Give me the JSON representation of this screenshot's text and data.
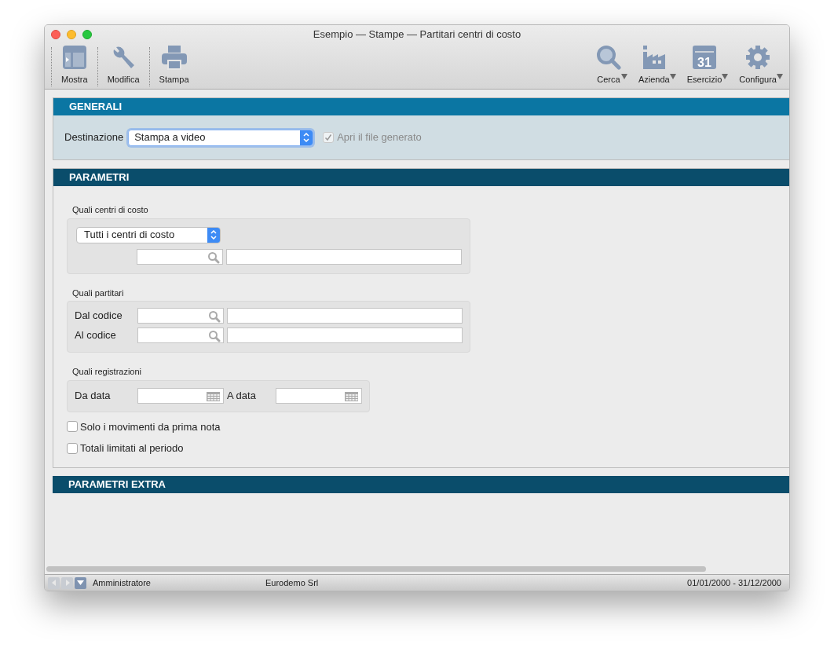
{
  "window": {
    "title": "Esempio — Stampe — Partitari centri di costo"
  },
  "toolbar": {
    "left": [
      {
        "label": "Mostra",
        "kind": "layout"
      },
      {
        "label": "Modifica",
        "kind": "wrench"
      },
      {
        "label": "Stampa",
        "kind": "printer"
      }
    ],
    "right": [
      {
        "label": "Cerca",
        "kind": "search"
      },
      {
        "label": "Azienda",
        "kind": "factory"
      },
      {
        "label": "Esercizio",
        "kind": "calendar",
        "icon_text": "31"
      },
      {
        "label": "Configura",
        "kind": "gear"
      }
    ]
  },
  "generali": {
    "title": "GENERALI",
    "destinazione": {
      "label": "Destinazione",
      "value": "Stampa a video"
    },
    "open_file": {
      "label": "Apri il file generato",
      "checked": true,
      "disabled": true
    }
  },
  "parametri": {
    "title": "PARAMETRI",
    "centri": {
      "label": "Quali centri di costo",
      "select": "Tutti i centri di costo"
    },
    "partitari": {
      "label": "Quali partitari",
      "rows": [
        {
          "label": "Dal codice"
        },
        {
          "label": "Al codice"
        }
      ]
    },
    "registrazioni": {
      "label": "Quali registrazioni",
      "from": "Da data",
      "to": "A data"
    },
    "options": [
      {
        "label": "Solo i movimenti da prima nota",
        "checked": false
      },
      {
        "label": "Totali limitati al periodo",
        "checked": false
      }
    ]
  },
  "parametri_extra": {
    "title": "PARAMETRI EXTRA"
  },
  "status_bar": {
    "user": "Amministratore",
    "company": "Eurodemo Srl",
    "period": "01/01/2000 - 31/12/2000"
  }
}
